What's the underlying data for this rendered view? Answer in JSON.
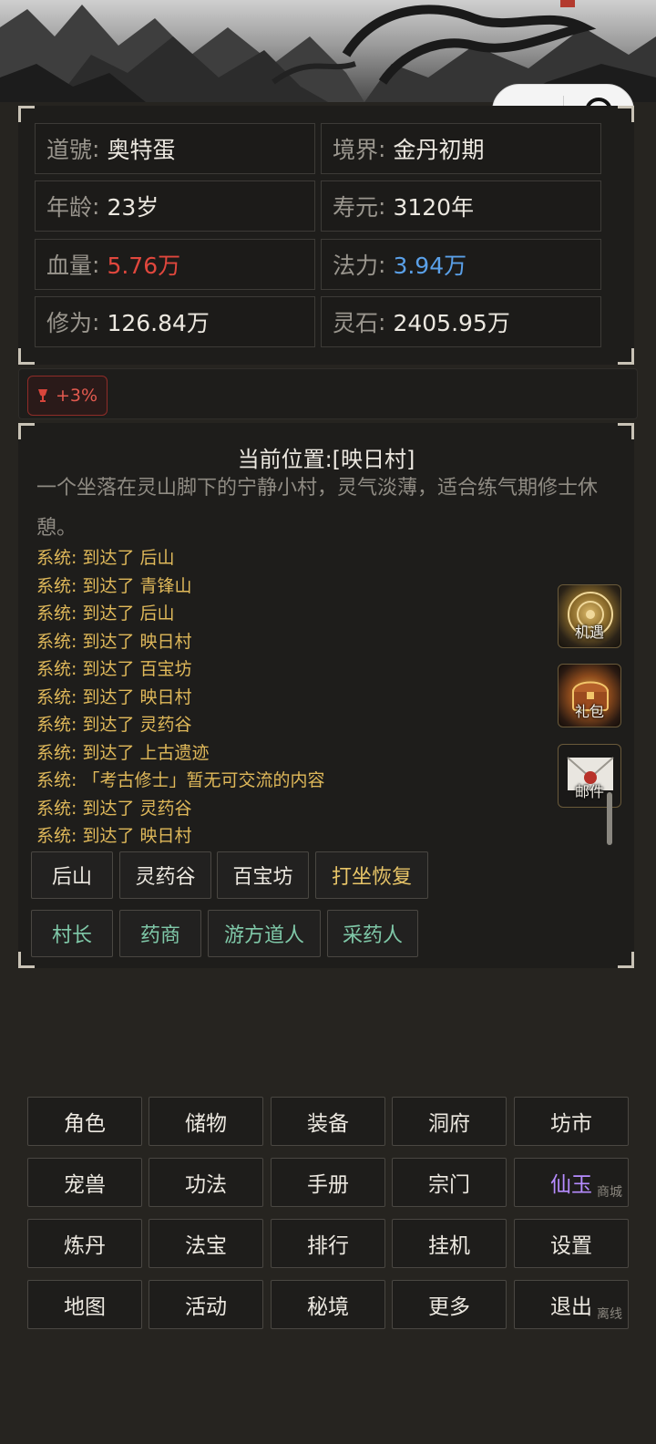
{
  "stats": {
    "dao_label": "道號",
    "dao_value": "奥特蛋",
    "realm_label": "境界",
    "realm_value": "金丹初期",
    "age_label": "年龄",
    "age_value": "23岁",
    "life_label": "寿元",
    "life_value": "3120年",
    "hp_label": "血量",
    "hp_value": "5.76万",
    "mp_label": "法力",
    "mp_value": "3.94万",
    "cult_label": "修为",
    "cult_value": "126.84万",
    "stone_label": "灵石",
    "stone_value": "2405.95万",
    "colors": {
      "hp": "#e0473d",
      "mp": "#5aa0e8"
    }
  },
  "buff": {
    "icon": "goblet-icon",
    "text": "+3%"
  },
  "location": {
    "title": "当前位置:[映日村]",
    "description": "一个坐落在灵山脚下的宁静小村，灵气淡薄，适合练气期修士休憩。"
  },
  "log": [
    "系统: 到达了 后山",
    "系统: 到达了 青锋山",
    "系统: 到达了 后山",
    "系统: 到达了 映日村",
    "系统: 到达了 百宝坊",
    "系统: 到达了 映日村",
    "系统: 到达了 灵药谷",
    "系统: 到达了 上古遗迹",
    "系统: 「考古修士」暂无可交流的内容",
    "系统: 到达了 灵药谷",
    "系统: 到达了 映日村"
  ],
  "side_buttons": {
    "chance": "机遇",
    "gift": "礼包",
    "mail": "邮件"
  },
  "places": {
    "p1": "后山",
    "p2": "灵药谷",
    "p3": "百宝坊",
    "rest": "打坐恢复"
  },
  "npcs": {
    "n1": "村长",
    "n2": "药商",
    "n3": "游方道人",
    "n4": "采药人"
  },
  "menu": {
    "role": "角色",
    "storage": "储物",
    "equip": "装备",
    "cave": "洞府",
    "market": "坊市",
    "pet": "宠兽",
    "skill": "功法",
    "manual": "手册",
    "sect": "宗门",
    "jade": "仙玉",
    "jade_sub": "商城",
    "alchemy": "炼丹",
    "artifact": "法宝",
    "rank": "排行",
    "idle": "挂机",
    "settings": "设置",
    "map": "地图",
    "event": "活动",
    "realm": "秘境",
    "more": "更多",
    "logout": "退出",
    "logout_sub": "离线"
  },
  "colors": {
    "background": "#262420",
    "gold_text": "#e0b95a",
    "npc_text": "#7fc8a8",
    "jade": "#b68cff"
  }
}
